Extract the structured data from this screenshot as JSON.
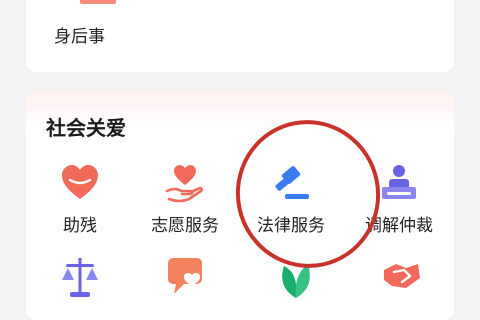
{
  "top_card": {
    "item_label": "身后事",
    "icon": "memorial-icon"
  },
  "social_care": {
    "title": "社会关爱",
    "row1": [
      {
        "label": "助残",
        "icon": "heart-icon"
      },
      {
        "label": "志愿服务",
        "icon": "helping-hand-heart-icon"
      },
      {
        "label": "法律服务",
        "icon": "gavel-icon"
      },
      {
        "label": "调解仲裁",
        "icon": "mediation-desk-icon"
      }
    ],
    "row2_icons": [
      "scales-icon",
      "chat-heart-icon",
      "leaf-icon",
      "handshake-icon"
    ]
  },
  "colors": {
    "accent_red": "#f26a5a",
    "accent_blue": "#3a7bf2",
    "accent_purple": "#6a63e6",
    "accent_green": "#1aae6f",
    "highlight_circle": "#c8322a"
  }
}
